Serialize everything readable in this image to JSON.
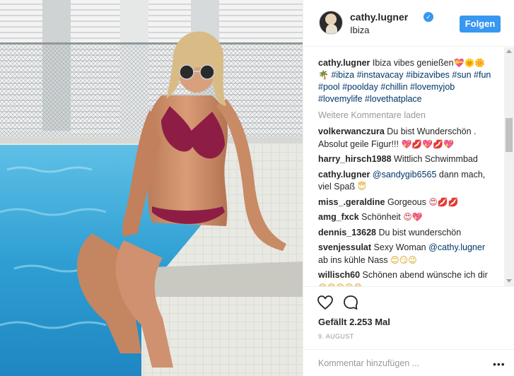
{
  "post": {
    "username": "cathy.lugner",
    "location": "Ibiza",
    "follow_label": "Folgen",
    "verified_glyph": "✓"
  },
  "caption": {
    "username": "cathy.lugner",
    "text": "Ibiza vibes genießen",
    "emoji": "💝🌞🌼🌴",
    "hashtags": [
      "#ibiza",
      "#instavacay",
      "#ibizavibes",
      "#sun",
      "#fun",
      "#pool",
      "#poolday",
      "#chillin",
      "#lovemyjob",
      "#lovemylife",
      "#lovethatplace"
    ]
  },
  "load_more_label": "Weitere Kommentare laden",
  "comments": [
    {
      "user": "volkerwanczura",
      "text": "Du bist Wunderschön . Absolut geile Figur!!!",
      "emoji": "💖💋💖💋💖"
    },
    {
      "user": "harry_hirsch1988",
      "text": "Wittlich Schwimmbad",
      "emoji": ""
    },
    {
      "user": "cathy.lugner",
      "mention": "@sandygib6565",
      "text": "dann mach, viel Spaß",
      "emoji": "😇"
    },
    {
      "user": "miss_.geraldine",
      "text": "Gorgeous",
      "emoji": "😍💋💋"
    },
    {
      "user": "amg_fxck",
      "text": "Schönheit",
      "emoji": "😍💖"
    },
    {
      "user": "dennis_13628",
      "text": "Du bist wunderschön",
      "emoji": ""
    },
    {
      "user": "svenjessulat",
      "text": "Sexy Woman",
      "mention": "@cathy.lugner",
      "text2": "ab ins kühle Nass",
      "emoji": "😊😏😉"
    },
    {
      "user": "willisch60",
      "text": "Schönen abend wünsche ich dir",
      "emoji": "😊😊😆😆😊"
    }
  ],
  "footer": {
    "likes_label": "Gefällt 2.253 Mal",
    "date": "9. AUGUST",
    "comment_placeholder": "Kommentar hinzufügen ...",
    "more_glyph": "•••"
  },
  "colors": {
    "accent": "#3897f0",
    "hashtag": "#003569",
    "muted": "#999999",
    "pool": "#2f9fd3"
  }
}
